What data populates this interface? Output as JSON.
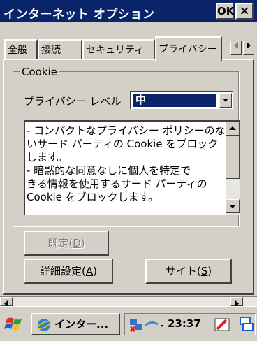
{
  "window": {
    "title": "インターネット オプション",
    "ok_label": "OK",
    "close_label": "×"
  },
  "tabs": [
    {
      "label": "全般"
    },
    {
      "label": "接続"
    },
    {
      "label": "セキュリティ"
    },
    {
      "label": "プライバシー"
    }
  ],
  "cookie_group": {
    "legend": "Cookie",
    "level_label": "プライバシー レベル",
    "level_value": "中",
    "description_lines": [
      "- コンパクトなプライバシー ポリシーのな",
      "いサード パーティの Cookie をブロック",
      "します。",
      "- 暗黙的な同意なしに個人を特定で",
      "きる情報を使用するサード パーティの",
      "Cookie をブロックします。"
    ]
  },
  "buttons": {
    "default_label": "既定",
    "default_key": "D",
    "advanced_label": "詳細設定",
    "advanced_key": "A",
    "sites_label": "サイト",
    "sites_key": "S"
  },
  "taskbar": {
    "task_label": "インター...",
    "clock": "23:37"
  },
  "colors": {
    "titlebar": "#0a246a",
    "face": "#d4d0c8",
    "selection": "#0a246a"
  }
}
